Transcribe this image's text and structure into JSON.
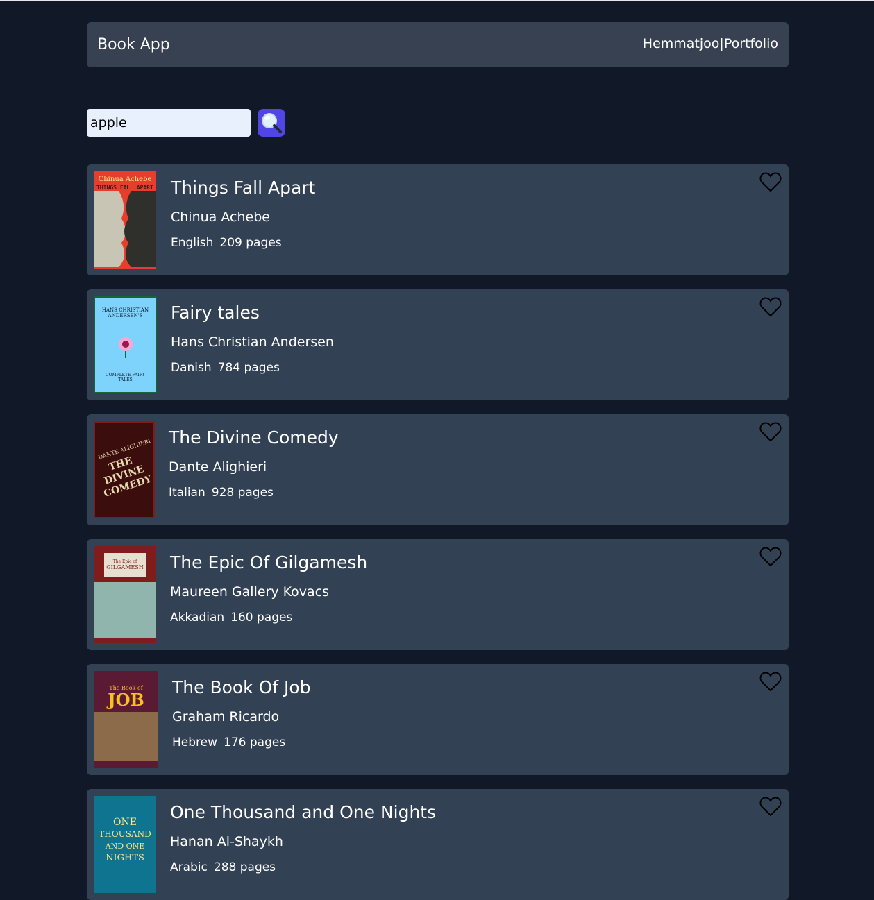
{
  "header": {
    "brand": "Book App",
    "links": [
      "Hemmatjoo",
      "|",
      "Portfolio"
    ]
  },
  "search": {
    "value": "apple",
    "button_icon": "search-icon"
  },
  "books": [
    {
      "title": "Things Fall Apart",
      "author": "Chinua Achebe",
      "language": "English",
      "pages": "209 pages",
      "cover_lines": [
        "Chinua Achebe",
        "THINGS FALL APART"
      ]
    },
    {
      "title": "Fairy tales",
      "author": "Hans Christian Andersen",
      "language": "Danish",
      "pages": "784 pages",
      "cover_lines": [
        "HANS CHRISTIAN ANDERSEN'S",
        "COMPLETE FAIRY TALES"
      ]
    },
    {
      "title": "The Divine Comedy",
      "author": "Dante Alighieri",
      "language": "Italian",
      "pages": "928 pages",
      "cover_lines": [
        "DANTE ALIGHIERI",
        "THE DIVINE COMEDY"
      ]
    },
    {
      "title": "The Epic Of Gilgamesh",
      "author": "Maureen Gallery Kovacs",
      "language": "Akkadian",
      "pages": "160 pages",
      "cover_lines": [
        "The Epic of",
        "GILGAMESH"
      ]
    },
    {
      "title": "The Book Of Job",
      "author": "Graham Ricardo",
      "language": "Hebrew",
      "pages": "176 pages",
      "cover_lines": [
        "The Book of",
        "JOB"
      ]
    },
    {
      "title": "One Thousand and One Nights",
      "author": "Hanan Al-Shaykh",
      "language": "Arabic",
      "pages": "288 pages",
      "cover_lines": [
        "ONE",
        "THOUSAND",
        "AND ONE",
        "NIGHTS"
      ]
    }
  ],
  "colors": {
    "background": "#111827",
    "card": "#334155",
    "navbar": "#374151",
    "search_button": "#4f46e5"
  }
}
